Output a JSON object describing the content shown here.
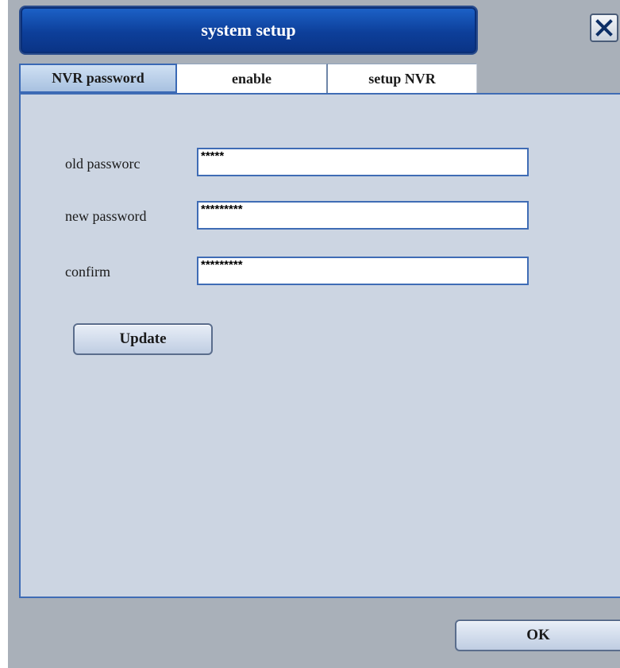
{
  "window": {
    "title": "system setup",
    "close_icon": "close-icon"
  },
  "tabs": [
    {
      "label": "NVR password",
      "active": true
    },
    {
      "label": "enable",
      "active": false
    },
    {
      "label": "setup NVR",
      "active": false
    }
  ],
  "form": {
    "old_password": {
      "label": "old passworc",
      "value": "*****"
    },
    "new_password": {
      "label": "new password",
      "value": "*********"
    },
    "confirm": {
      "label": "confirm",
      "value": "*********"
    },
    "update_label": "Update"
  },
  "footer": {
    "ok_label": "OK"
  },
  "colors": {
    "title_bar": "#0d3f9a",
    "panel_bg": "#ccd5e2",
    "window_bg": "#a9b0b9",
    "accent_border": "#3f6cb5"
  }
}
